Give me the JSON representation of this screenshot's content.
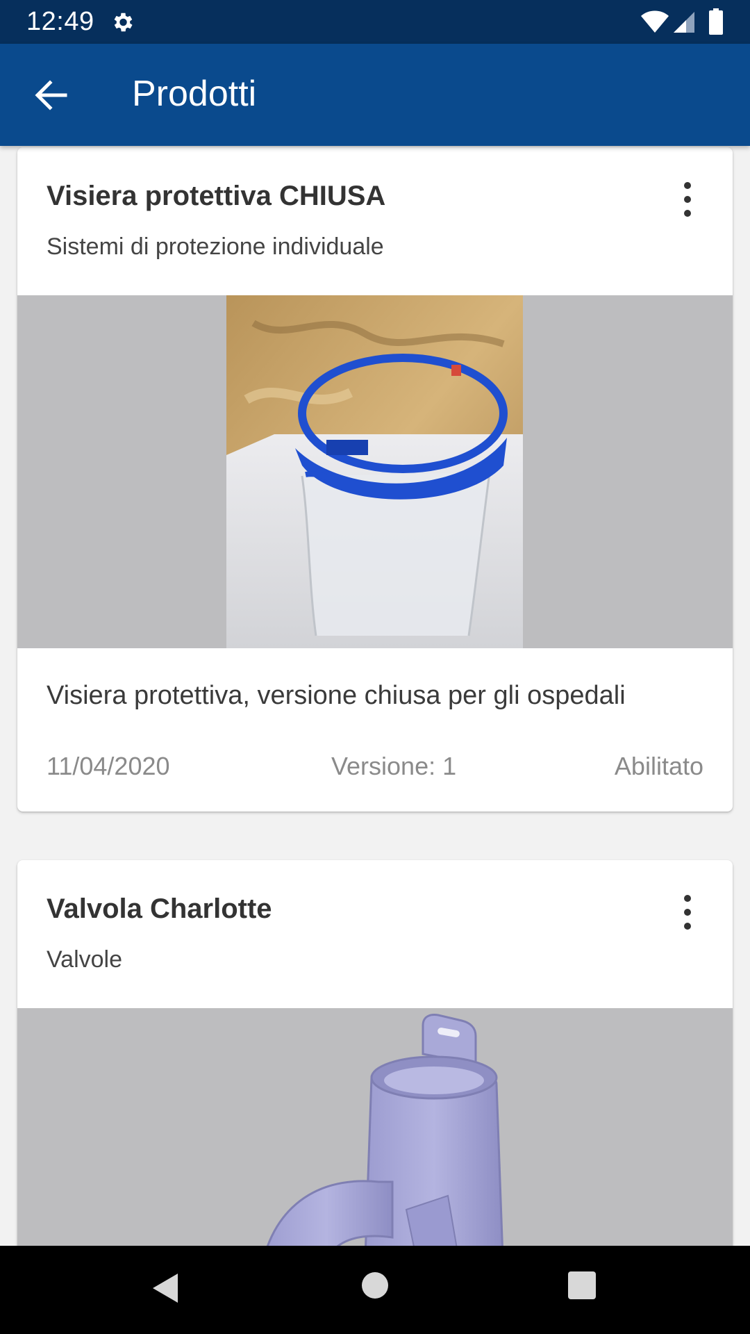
{
  "status_bar": {
    "time": "12:49",
    "icons": [
      "gear-icon",
      "wifi-icon",
      "signal-icon",
      "battery-icon"
    ]
  },
  "app_bar": {
    "title": "Prodotti",
    "back_icon": "arrow-left-icon"
  },
  "products": [
    {
      "title": "Visiera protettiva CHIUSA",
      "category": "Sistemi di protezione individuale",
      "description": "Visiera protettiva, versione chiusa per gli ospedali",
      "date": "11/04/2020",
      "version": "Versione: 1",
      "status": "Abilitato"
    },
    {
      "title": "Valvola Charlotte",
      "category": "Valvole"
    }
  ],
  "colors": {
    "status_bar": "#062f5c",
    "app_bar": "#0a4a8d",
    "media_bg": "#bdbdbf",
    "visor_blue": "#1f4fd0",
    "valve_purple": "#a7a7d6"
  },
  "nav_bar": {
    "icons": [
      "back-triangle-icon",
      "home-circle-icon",
      "recents-square-icon"
    ]
  }
}
